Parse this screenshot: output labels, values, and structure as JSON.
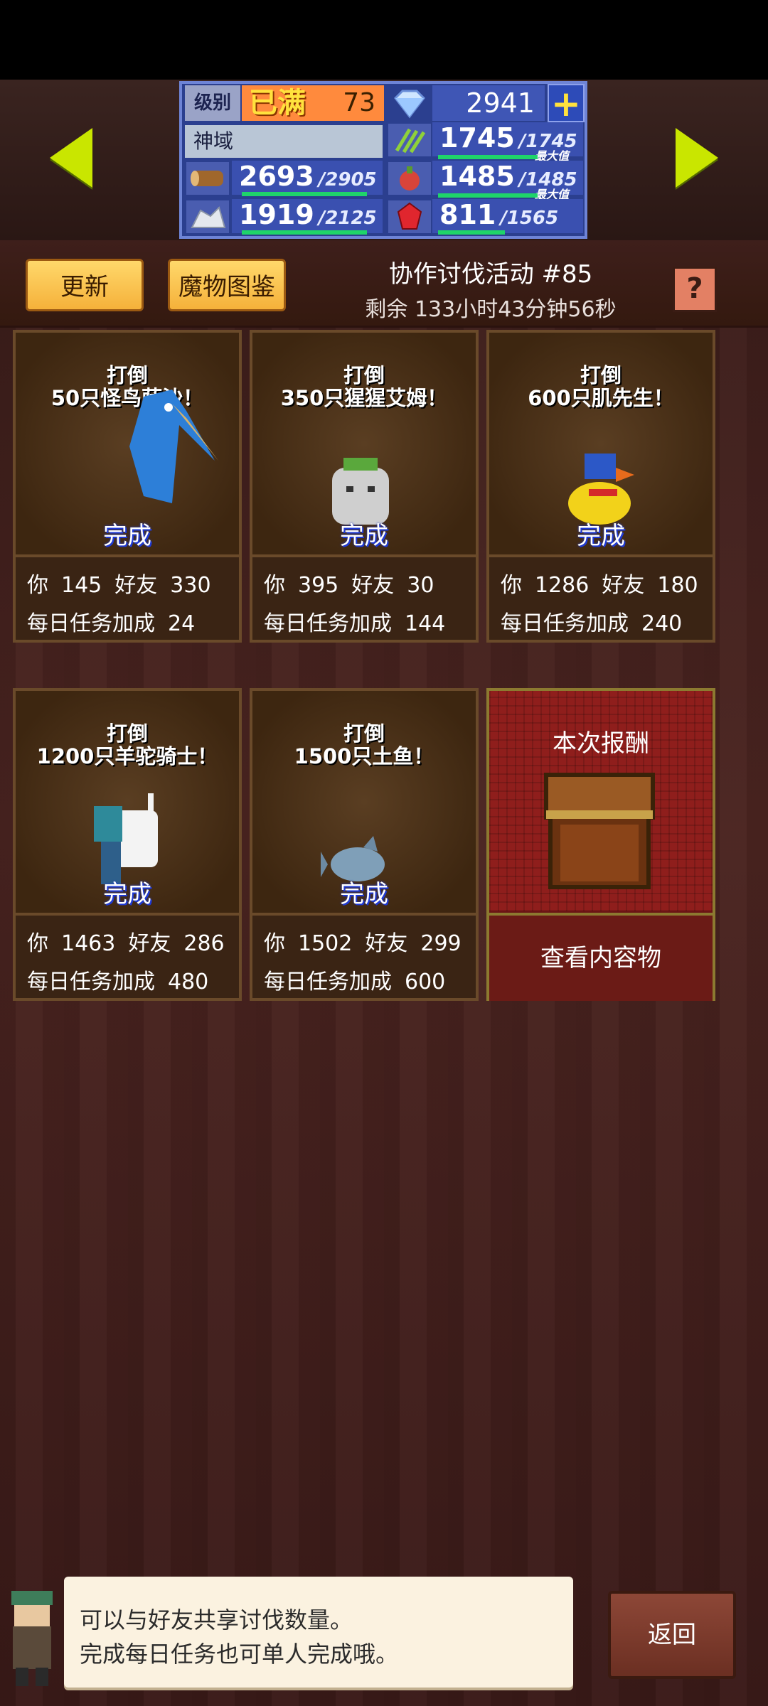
{
  "header": {
    "level_label": "级别",
    "level_max": "已满",
    "level_value": "73",
    "gems": "2941",
    "realm_label": "神域",
    "resources": [
      {
        "icon": "log-icon",
        "value": "2693",
        "cap": "/2905"
      },
      {
        "icon": "ore-icon",
        "value": "1919",
        "cap": "/2125"
      },
      {
        "icon": "grass-icon",
        "value": "1745",
        "cap": "/1745",
        "sub": "最大值"
      },
      {
        "icon": "food-icon",
        "value": "1485",
        "cap": "/1485",
        "sub": "最大值"
      },
      {
        "icon": "ruby-icon",
        "value": "811",
        "cap": "/1565"
      }
    ]
  },
  "toolbar": {
    "refresh_label": "更新",
    "bestiary_label": "魔物图鉴",
    "event_title": "协作讨伐活动 #85",
    "remaining": "剩余 133小时43分钟56秒",
    "help_label": "?"
  },
  "quests": [
    {
      "title1": "打倒",
      "title2": "50只怪鸟萨沙！",
      "status": "完成",
      "you_label": "你",
      "you": "145",
      "friend_label": "好友",
      "friend": "330",
      "daily_label": "每日任务加成",
      "daily": "24"
    },
    {
      "title1": "打倒",
      "title2": "350只猩猩艾姆！",
      "status": "完成",
      "you_label": "你",
      "you": "395",
      "friend_label": "好友",
      "friend": "30",
      "daily_label": "每日任务加成",
      "daily": "144"
    },
    {
      "title1": "打倒",
      "title2": "600只肌先生！",
      "status": "完成",
      "you_label": "你",
      "you": "1286",
      "friend_label": "好友",
      "friend": "180",
      "daily_label": "每日任务加成",
      "daily": "240"
    },
    {
      "title1": "打倒",
      "title2": "1200只羊驼骑士！",
      "status": "完成",
      "you_label": "你",
      "you": "1463",
      "friend_label": "好友",
      "friend": "286",
      "daily_label": "每日任务加成",
      "daily": "480"
    },
    {
      "title1": "打倒",
      "title2": "1500只土鱼！",
      "status": "完成",
      "you_label": "你",
      "you": "1502",
      "friend_label": "好友",
      "friend": "299",
      "daily_label": "每日任务加成",
      "daily": "600"
    }
  ],
  "reward": {
    "title": "本次报酬",
    "view_label": "查看内容物"
  },
  "dialog": {
    "line1": "可以与好友共享讨伐数量。",
    "line2": "完成每日任务也可单人完成哦。"
  },
  "back_label": "返回",
  "colors": {
    "accent_yellow": "#f5b13a",
    "arrow_green": "#c9e600",
    "done_blue": "#1f3ad6",
    "bar_green": "#1fd46a"
  }
}
